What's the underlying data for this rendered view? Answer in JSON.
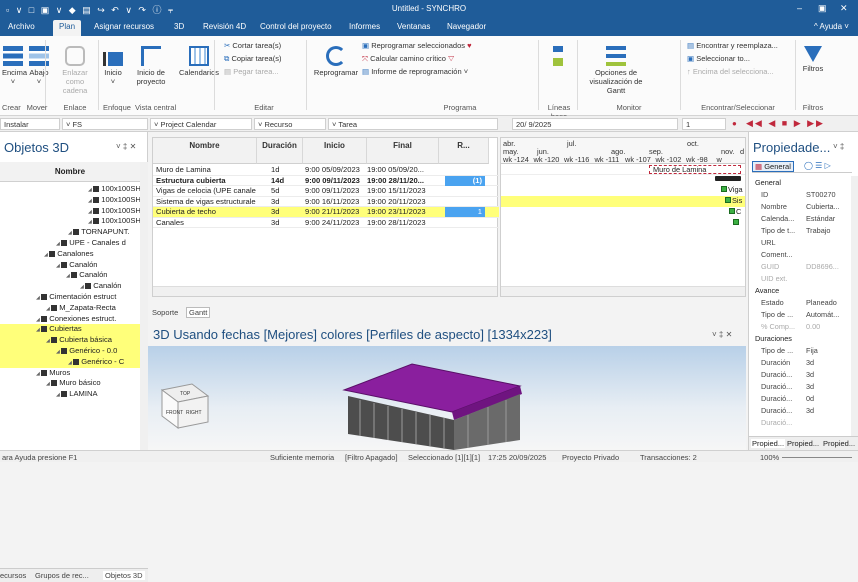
{
  "titlebar": {
    "title": "Untitled - SYNCHRO",
    "quick_access": "▫ ∨ □ ▣ ∨ ◆ ▤ ↪ ↶ ∨ ↷ ⓘ ⫧"
  },
  "menu": {
    "tabs": [
      "Archivo",
      "Plan",
      "Asignar recursos",
      "3D",
      "Revisión 4D",
      "Control del proyecto",
      "Informes",
      "Ventanas",
      "Navegador"
    ],
    "active": "Plan",
    "help": "^ Ayuda ˅"
  },
  "ribbon": {
    "encima": "Encima",
    "abajo": "Abajo",
    "enlazar": "Enlazar como cadena",
    "inicio": "Inicio",
    "inicio_proyecto": "Inicio de proyecto",
    "calendarios": "Calendarios",
    "cortar": "Cortar tarea(s)",
    "copiar": "Copiar tarea(s)",
    "pegar": "Pegar tarea...",
    "reprogramar": "Reprogramar",
    "reprogramar_sel": "Reprogramar seleccionados",
    "camino": "Calcular camino crítico",
    "informe": "Informe de reprogramación",
    "opciones": "Opciones de visualización de Gantt",
    "encontrar": "Encontrar y reemplaza...",
    "seleccionar": "Seleccionar to...",
    "encima_sel": "Encima del selecciona...",
    "filtros": "Filtros",
    "groups": {
      "crear": "Crear",
      "mover": "Mover",
      "enlace": "Enlace",
      "enfoque": "Enfoque",
      "vista": "Vista central",
      "editar": "Editar",
      "programa": "Programa",
      "lineas": "Líneas base",
      "monitor": "Monitor",
      "encontrar": "Encontrar/Seleccionar",
      "filtros": "Filtros"
    }
  },
  "toolbar": {
    "instalar": "Instalar",
    "fs": "FS",
    "calendar": "Project Calendar",
    "recurso": "Recurso",
    "tarea": "Tarea",
    "date": "20/ 9/2025",
    "zoom": "1"
  },
  "left_panel": {
    "title": "Objetos 3D",
    "column": "Nombre",
    "rows": [
      {
        "label": "100x100SHS",
        "indent": 88
      },
      {
        "label": "100x100SHS",
        "indent": 88
      },
      {
        "label": "100x100SHS",
        "indent": 88
      },
      {
        "label": "100x100SHS",
        "indent": 88
      },
      {
        "label": "TORNAPUNT.",
        "indent": 68
      },
      {
        "label": "UPE - Canales d",
        "indent": 56
      },
      {
        "label": "Canalones",
        "indent": 44
      },
      {
        "label": "Canalón",
        "indent": 56
      },
      {
        "label": "Canalón",
        "indent": 66
      },
      {
        "label": "Canalón",
        "indent": 80
      },
      {
        "label": "Cimentación estruct",
        "indent": 36
      },
      {
        "label": "M_Zapata-Recta",
        "indent": 46
      },
      {
        "label": "Conexiones estruct.",
        "indent": 36
      },
      {
        "label": "Cubiertas",
        "indent": 36,
        "hl": true
      },
      {
        "label": "Cubierta básica",
        "indent": 46,
        "hl": true
      },
      {
        "label": "Genérico - 0.0",
        "indent": 56,
        "hl": true
      },
      {
        "label": "Genérico - C",
        "indent": 68,
        "hl": true
      },
      {
        "label": "Muros",
        "indent": 36
      },
      {
        "label": "Muro básico",
        "indent": 46
      },
      {
        "label": "LAMINA",
        "indent": 56
      }
    ],
    "tabs": [
      "ecursos",
      "Grupos de rec...",
      "Objetos 3D"
    ]
  },
  "grid": {
    "columns": [
      "Nombre",
      "Duración",
      "Inicio",
      "Final",
      "R..."
    ],
    "rows": [
      {
        "name": "Muro de Lamina",
        "dur": "1d",
        "start": "9:00 05/09/2023",
        "end": "19:00 05/09/20...",
        "r": ""
      },
      {
        "name": "Estructura cubierta",
        "dur": "14d",
        "start": "9:00 09/11/2023",
        "end": "19:00 28/11/20...",
        "r": "(1)",
        "bold": true
      },
      {
        "name": "Vigas de celocia (UPE canale...",
        "dur": "5d",
        "start": "9:00 09/11/2023",
        "end": "19:00 15/11/2023",
        "r": ""
      },
      {
        "name": "Sistema de vigas estructurales (shs. seccion hueca",
        "dur": "3d",
        "start": "9:00 16/11/2023",
        "end": "19:00 20/11/2023",
        "r": ""
      },
      {
        "name": "Cubierta de techo",
        "dur": "3d",
        "start": "9:00 21/11/2023",
        "end": "19:00 23/11/2023",
        "r": "1",
        "hl": true
      },
      {
        "name": "Canales",
        "dur": "3d",
        "start": "9:00 24/11/2023",
        "end": "19:00 28/11/2023",
        "r": ""
      }
    ],
    "tabs": [
      "Soporte",
      "Gantt"
    ]
  },
  "gantt": {
    "months": [
      "abr.",
      "jul.",
      "oct."
    ],
    "sub": [
      "may.",
      "jun.",
      "ago.",
      "sep.",
      "nov.",
      "d"
    ],
    "weeks": [
      "wk -124",
      "wk -120",
      "wk -116",
      "wk -111",
      "wk -107",
      "wk -102",
      "wk -98",
      "w"
    ],
    "bar_labels": [
      "Muro de Lamina",
      "Viga",
      "Sis",
      "C"
    ]
  },
  "view3d": {
    "title": "3D Usando fechas [Mejores] colores [Perfiles de aspecto]  [1334x223]",
    "cube_front": "FRONT",
    "cube_right": "RIGHT",
    "cube_top": "TOP"
  },
  "right_panel": {
    "title": "Propiedade...",
    "tab": "General",
    "rows": [
      {
        "k": "General",
        "v": "",
        "type": "sec"
      },
      {
        "k": "ID",
        "v": "ST00270"
      },
      {
        "k": "Nombre",
        "v": "Cubierta..."
      },
      {
        "k": "Calenda...",
        "v": "Estándar"
      },
      {
        "k": "Tipo de t...",
        "v": "Trabajo"
      },
      {
        "k": "URL",
        "v": ""
      },
      {
        "k": "Coment...",
        "v": ""
      },
      {
        "k": "GUID",
        "v": "DD8696...",
        "type": "dis"
      },
      {
        "k": "UID ext.",
        "v": "",
        "type": "dis"
      },
      {
        "k": "Avance",
        "v": "",
        "type": "sec"
      },
      {
        "k": "Estado",
        "v": "Planeado"
      },
      {
        "k": "Tipo de ...",
        "v": "Automát..."
      },
      {
        "k": "% Comp...",
        "v": "0.00",
        "type": "dis"
      },
      {
        "k": "Duraciones",
        "v": "",
        "type": "sec"
      },
      {
        "k": "Tipo de ...",
        "v": "Fija"
      },
      {
        "k": "Duración",
        "v": "3d"
      },
      {
        "k": "Duració...",
        "v": "3d"
      },
      {
        "k": "Duració...",
        "v": "3d"
      },
      {
        "k": "Duració...",
        "v": "0d"
      },
      {
        "k": "Duració...",
        "v": "3d"
      },
      {
        "k": "Duració...",
        "v": "",
        "type": "dis"
      }
    ],
    "tabs": [
      "Propied...",
      "Propied...",
      "Propied..."
    ]
  },
  "status": {
    "help": "ara Ayuda presione F1",
    "mem": "Suficiente memoria",
    "filter": "[Filtro Apagado]",
    "sel": "Seleccionado [1][1][1]",
    "time": "17:25 20/09/2025",
    "proj": "Proyecto Privado",
    "trans": "Transacciones: 2",
    "zoom": "100%"
  }
}
